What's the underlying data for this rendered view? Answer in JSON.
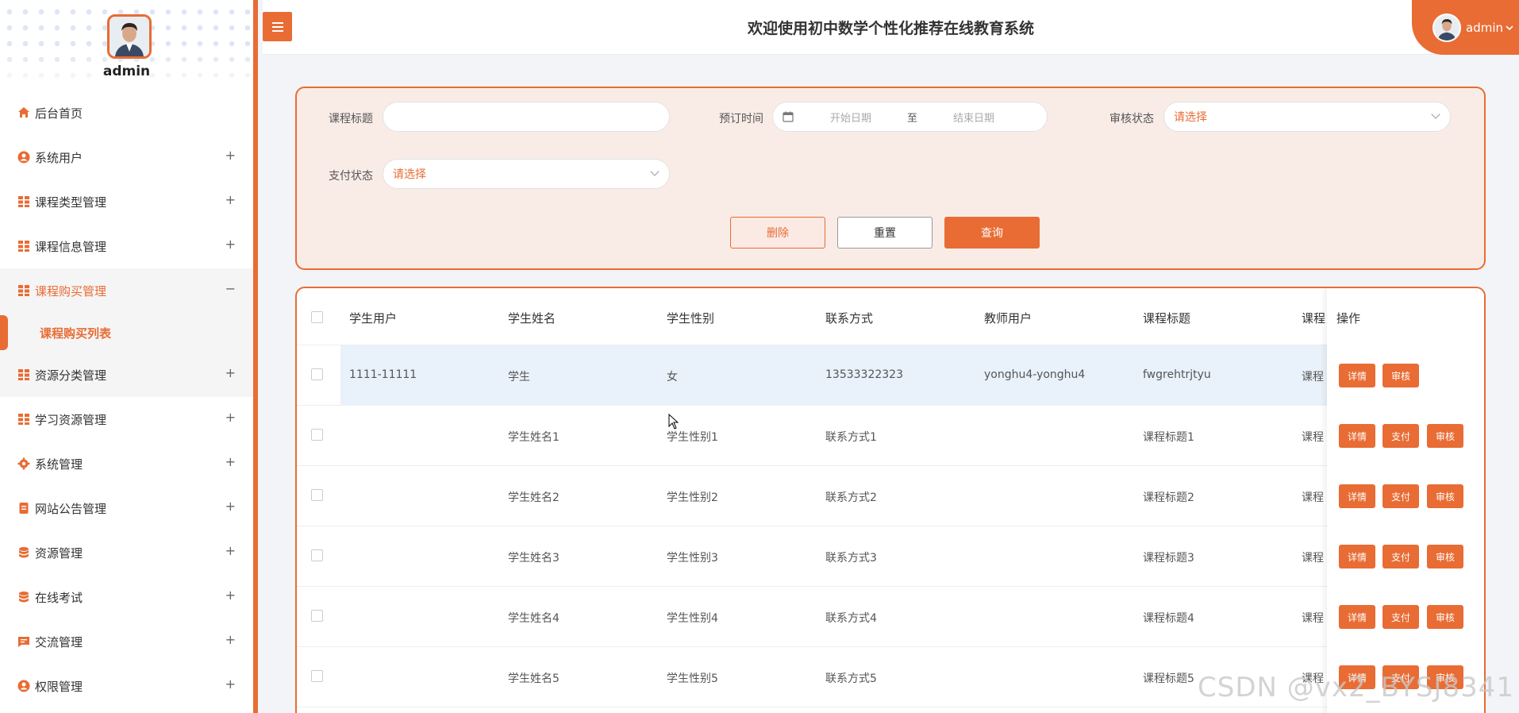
{
  "sidebar": {
    "username": "admin",
    "menu": [
      {
        "label": "后台首页",
        "icon": "home-icon",
        "sign": ""
      },
      {
        "label": "系统用户",
        "icon": "user-icon",
        "sign": "+"
      },
      {
        "label": "课程类型管理",
        "icon": "grid-icon",
        "sign": "+"
      },
      {
        "label": "课程信息管理",
        "icon": "grid-icon",
        "sign": "+"
      },
      {
        "label": "课程购买管理",
        "icon": "grid-icon",
        "sign": "−"
      },
      {
        "label": "资源分类管理",
        "icon": "grid-icon",
        "sign": "+"
      },
      {
        "label": "学习资源管理",
        "icon": "grid-icon",
        "sign": "+"
      },
      {
        "label": "系统管理",
        "icon": "gear-icon",
        "sign": "+"
      },
      {
        "label": "网站公告管理",
        "icon": "document-icon",
        "sign": "+"
      },
      {
        "label": "资源管理",
        "icon": "database-icon",
        "sign": "+"
      },
      {
        "label": "在线考试",
        "icon": "database-icon",
        "sign": "+"
      },
      {
        "label": "交流管理",
        "icon": "chat-icon",
        "sign": "+"
      },
      {
        "label": "权限管理",
        "icon": "user-icon",
        "sign": "+"
      }
    ],
    "submenu": {
      "label": "课程购买列表"
    }
  },
  "header": {
    "title": "欢迎使用初中数学个性化推荐在线教育系统",
    "user": "admin"
  },
  "filter": {
    "course_title_label": "课程标题",
    "course_title_value": "",
    "order_time_label": "预订时间",
    "start_date_placeholder": "开始日期",
    "range_sep": "至",
    "end_date_placeholder": "结束日期",
    "review_status_label": "审核状态",
    "review_status_value": "请选择",
    "pay_status_label": "支付状态",
    "pay_status_value": "请选择",
    "delete_label": "删除",
    "reset_label": "重置",
    "query_label": "查询"
  },
  "table": {
    "columns": [
      "学生用户",
      "学生姓名",
      "学生性别",
      "联系方式",
      "教师用户",
      "课程标题",
      "课程"
    ],
    "ops_header": "操作",
    "rows": [
      {
        "cells": [
          "1111-11111",
          "学生",
          "女",
          "13533322323",
          "yonghu4-yonghu4",
          "fwgrehtrjtyu",
          "课程"
        ],
        "ops": [
          "详情",
          "审核"
        ]
      },
      {
        "cells": [
          "",
          "学生姓名1",
          "学生性别1",
          "联系方式1",
          "",
          "课程标题1",
          "课程"
        ],
        "ops": [
          "详情",
          "支付",
          "审核"
        ]
      },
      {
        "cells": [
          "",
          "学生姓名2",
          "学生性别2",
          "联系方式2",
          "",
          "课程标题2",
          "课程"
        ],
        "ops": [
          "详情",
          "支付",
          "审核"
        ]
      },
      {
        "cells": [
          "",
          "学生姓名3",
          "学生性别3",
          "联系方式3",
          "",
          "课程标题3",
          "课程"
        ],
        "ops": [
          "详情",
          "支付",
          "审核"
        ]
      },
      {
        "cells": [
          "",
          "学生姓名4",
          "学生性别4",
          "联系方式4",
          "",
          "课程标题4",
          "课程"
        ],
        "ops": [
          "详情",
          "支付",
          "审核"
        ]
      },
      {
        "cells": [
          "",
          "学生姓名5",
          "学生性别5",
          "联系方式5",
          "",
          "课程标题5",
          "课程"
        ],
        "ops": [
          "详情",
          "支付",
          "审核"
        ]
      }
    ]
  },
  "watermark": "CSDN @vx2_BYSJ8341",
  "colors": {
    "accent": "#e86c34",
    "filter_bg": "#f9ece7",
    "selected_row": "#e9f1fa"
  }
}
